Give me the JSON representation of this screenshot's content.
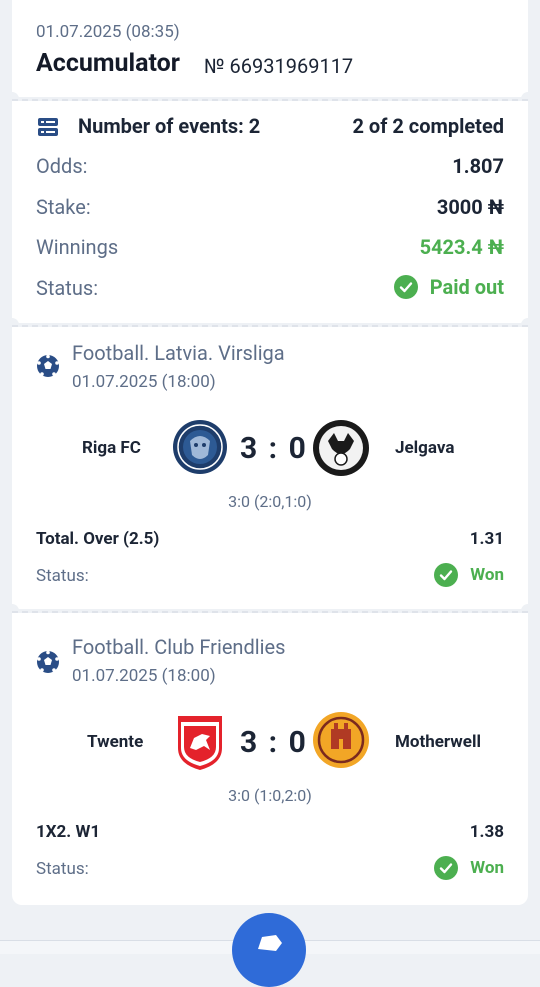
{
  "header": {
    "date": "01.07.2025 (08:35)",
    "title": "Accumulator",
    "number": "№ 66931969117"
  },
  "summary": {
    "events_label": "Number of events: 2",
    "completed": "2 of 2 completed",
    "odds_label": "Odds:",
    "odds_value": "1.807",
    "stake_label": "Stake:",
    "stake_value": "3000 ₦",
    "winnings_label": "Winnings",
    "winnings_value": "5423.4 ₦",
    "status_label": "Status:",
    "status_value": "Paid out"
  },
  "events": [
    {
      "league": "Football. Latvia. Virsliga",
      "date": "01.07.2025 (18:00)",
      "home": "Riga FC",
      "away": "Jelgava",
      "score": "3 : 0",
      "detail": "3:0 (2:0,1:0)",
      "market": "Total. Over (2.5)",
      "coef": "1.31",
      "status_label": "Status:",
      "status_value": "Won"
    },
    {
      "league": "Football. Club Friendlies",
      "date": "01.07.2025 (18:00)",
      "home": "Twente",
      "away": "Motherwell",
      "score": "3 : 0",
      "detail": "3:0 (1:0,2:0)",
      "market": "1X2. W1",
      "coef": "1.38",
      "status_label": "Status:",
      "status_value": "Won"
    }
  ],
  "icons": {
    "events": "list-icon",
    "sport": "soccer-ball-icon",
    "status": "check-circle-icon"
  },
  "colors": {
    "accent_green": "#4caf50",
    "accent_blue": "#2f6bd8",
    "text_muted": "#5e6e88"
  }
}
